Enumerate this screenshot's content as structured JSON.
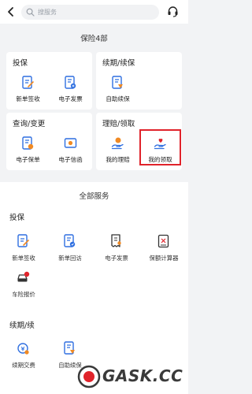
{
  "header": {
    "search_placeholder": "搜服务"
  },
  "section_title": "保险4部",
  "cards": {
    "insure": {
      "title": "投保",
      "items": [
        {
          "label": "新单签收",
          "icon": "sign-document-icon"
        },
        {
          "label": "电子发票",
          "icon": "invoice-icon"
        }
      ]
    },
    "renew": {
      "title": "续期/续保",
      "items": [
        {
          "label": "自助续保",
          "icon": "renewal-document-icon"
        }
      ]
    },
    "query": {
      "title": "查询/变更",
      "items": [
        {
          "label": "电子保单",
          "icon": "e-policy-icon"
        },
        {
          "label": "电子信函",
          "icon": "e-letter-icon"
        }
      ]
    },
    "claim": {
      "title": "理赔/领取",
      "items": [
        {
          "label": "我的理赔",
          "icon": "claim-hand-coin-icon"
        },
        {
          "label": "我的领取",
          "icon": "receive-hand-heart-icon"
        }
      ]
    }
  },
  "all_services": {
    "title": "全部服务",
    "insure": {
      "title": "投保",
      "items": [
        {
          "label": "新单签收",
          "icon": "sign-document-icon"
        },
        {
          "label": "新单回访",
          "icon": "revisit-document-icon"
        },
        {
          "label": "电子发票",
          "icon": "invoice-icon"
        },
        {
          "label": "保额计算器",
          "icon": "calculator-icon"
        },
        {
          "label": "车险报价",
          "icon": "car-quote-icon"
        }
      ]
    },
    "renew": {
      "title": "续期/续",
      "items": [
        {
          "label": "续期交费",
          "icon": "renewal-payment-icon"
        },
        {
          "label": "自助续保",
          "icon": "renewal-document-icon"
        }
      ]
    }
  },
  "watermark": {
    "text": "GASK.CC"
  },
  "colors": {
    "accent_blue": "#2f6fe0",
    "accent_orange": "#f08a24",
    "highlight_red": "#e0232b",
    "background": "#f2f3f5"
  }
}
